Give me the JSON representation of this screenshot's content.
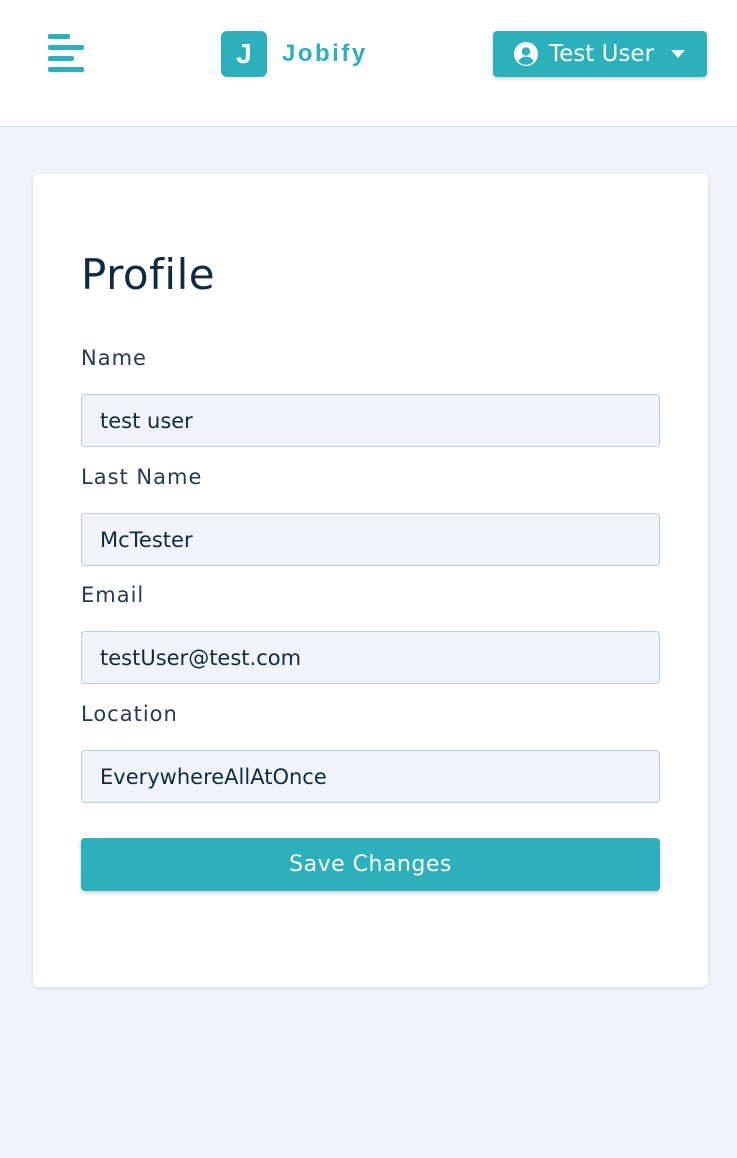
{
  "colors": {
    "accent": "#2cb1bc",
    "page_bg": "#f0f4f8",
    "card_bg": "#ffffff",
    "text": "#102a43"
  },
  "navbar": {
    "menu_icon": "align-left-icon",
    "logo": {
      "mark": "J",
      "text": "Jobify"
    },
    "user_menu": {
      "icon": "user-circle-icon",
      "label": "Test User",
      "caret_icon": "caret-down-icon"
    }
  },
  "profile": {
    "title": "Profile",
    "fields": [
      {
        "label": "Name",
        "value": "test user"
      },
      {
        "label": "Last Name",
        "value": "McTester"
      },
      {
        "label": "Email",
        "value": "testUser@test.com"
      },
      {
        "label": "Location",
        "value": "EverywhereAllAtOnce"
      }
    ],
    "submit_label": "Save Changes"
  }
}
